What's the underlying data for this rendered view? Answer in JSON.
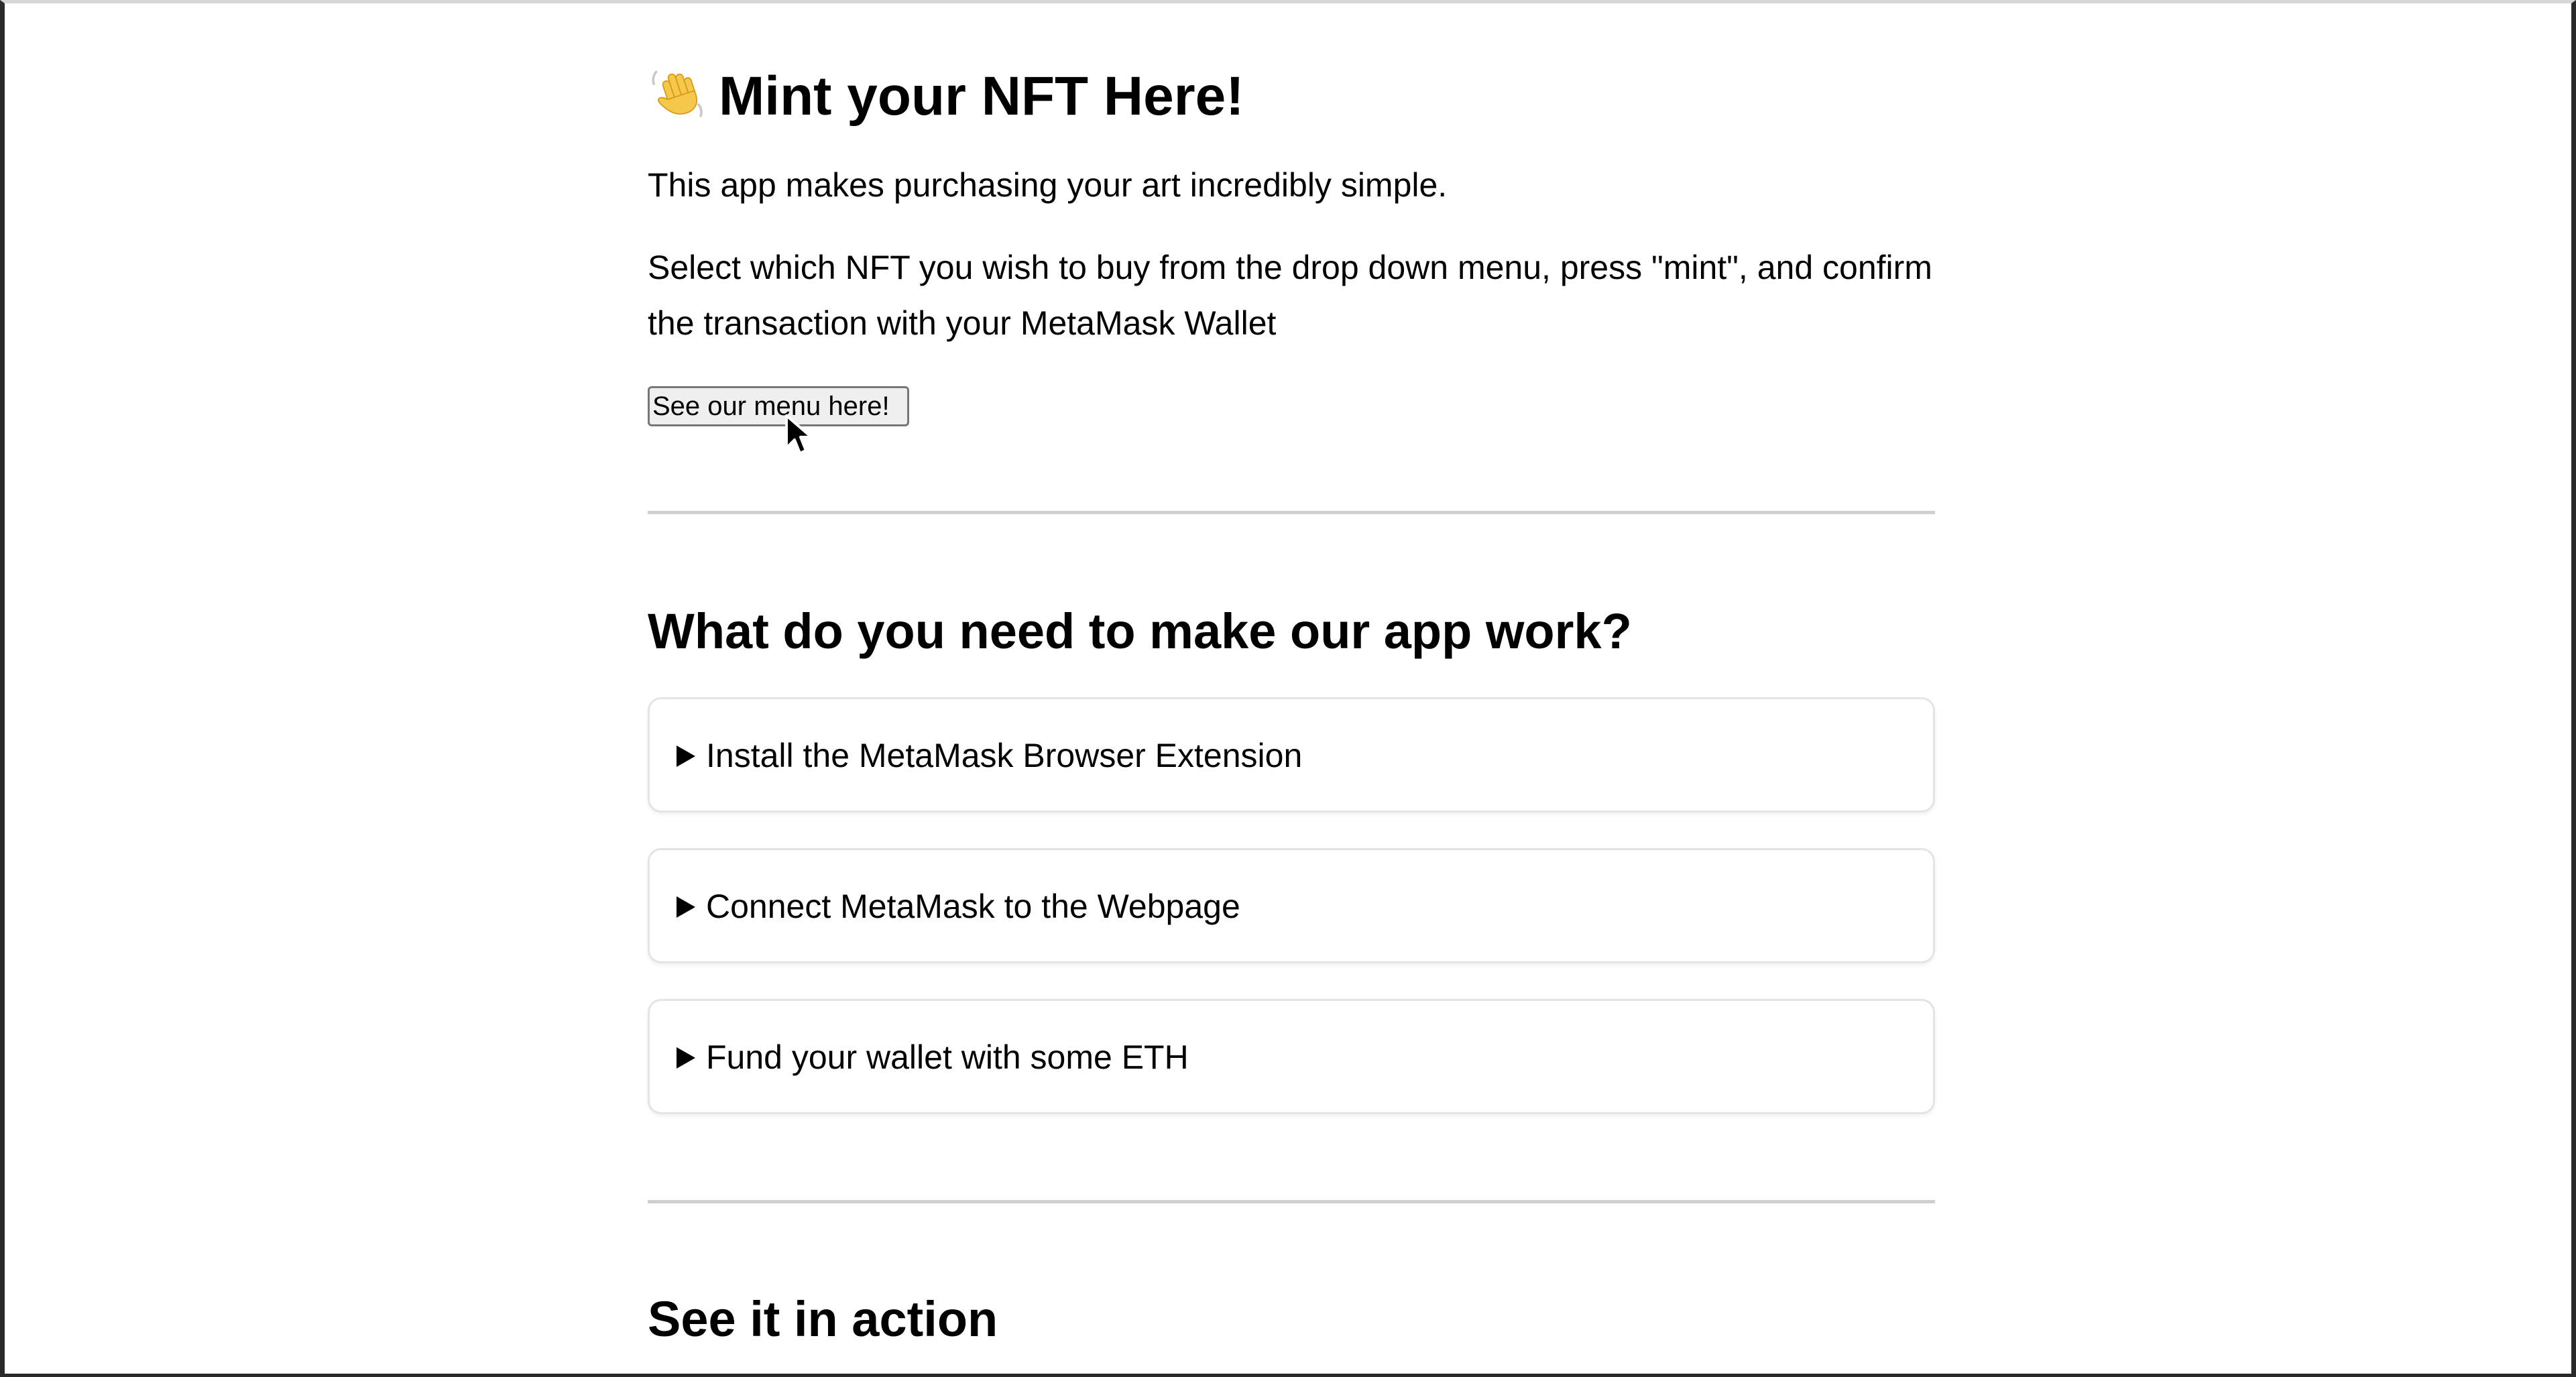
{
  "page": {
    "title": "Mint your NFT Here!",
    "title_icon": "waving-hand-icon",
    "intro": "This app makes purchasing your art incredibly simple.",
    "instructions": "Select which NFT you wish to buy from the drop down menu, press \"mint\", and confirm the transaction with your MetaMask Wallet",
    "menu_button_label": "See our menu here!"
  },
  "requirements": {
    "heading": "What do you need to make our app work?",
    "items": [
      {
        "label": "Install the MetaMask Browser Extension",
        "icon": "disclosure-triangle-icon",
        "expanded": false
      },
      {
        "label": "Connect MetaMask to the Webpage",
        "icon": "disclosure-triangle-icon",
        "expanded": false
      },
      {
        "label": "Fund your wallet with some ETH",
        "icon": "disclosure-triangle-icon",
        "expanded": false
      }
    ]
  },
  "action": {
    "heading": "See it in action"
  },
  "cursor": {
    "icon": "mouse-pointer-icon"
  },
  "colors": {
    "background": "#ffffff",
    "text": "#000000",
    "divider": "#cfcfcf",
    "card_border": "#e4e4e4",
    "button_background": "#efefef",
    "button_border": "#777777"
  }
}
